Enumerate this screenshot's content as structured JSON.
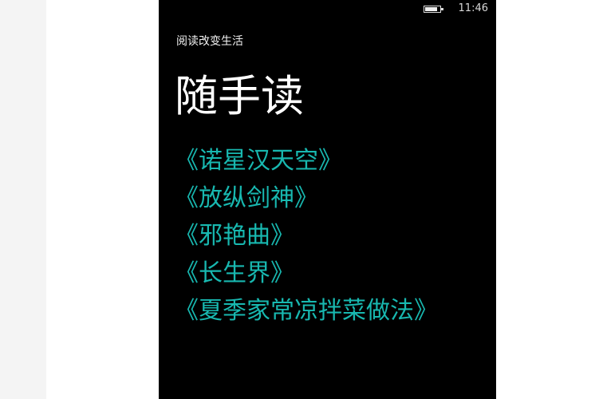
{
  "status_bar": {
    "battery_level": 0.85,
    "time": "11:46"
  },
  "header": {
    "subtitle": "阅读改变生活",
    "title": "随手读"
  },
  "books": [
    {
      "title": "《诺星汉天空》"
    },
    {
      "title": "《放纵剑神》"
    },
    {
      "title": "《邪艳曲》"
    },
    {
      "title": "《长生界》"
    },
    {
      "title": "《夏季家常凉拌菜做法》"
    }
  ],
  "colors": {
    "screen_background": "#000000",
    "accent": "#18b8b0",
    "text_primary": "#ffffff"
  },
  "icons": {
    "battery": "battery-icon"
  }
}
